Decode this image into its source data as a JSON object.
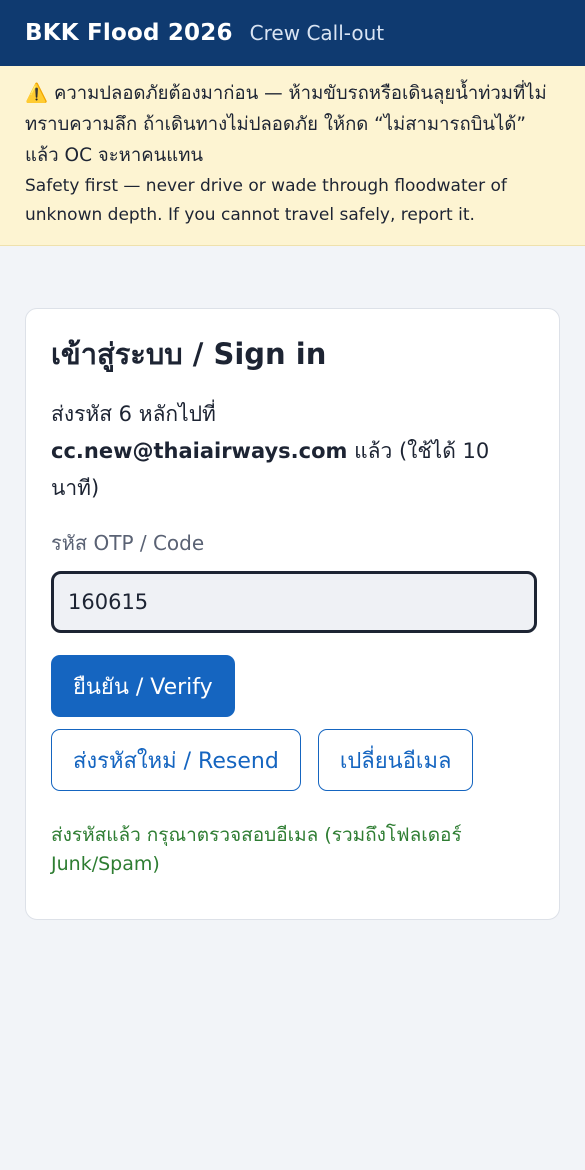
{
  "header": {
    "title": "BKK Flood 2026",
    "subtitle": "Crew Call-out"
  },
  "banner": {
    "icon": "warning-icon",
    "icon_glyph": "⚠️",
    "text_th": "ความปลอดภัยต้องมาก่อน — ห้ามขับรถหรือเดินลุยน้ำท่วมที่ไม่ทราบความลึก ถ้าเดินทางไม่ปลอดภัย ให้กด “ไม่สามารถบินได้” แล้ว OC จะหาคนแทน",
    "text_en": "Safety first — never drive or wade through floodwater of unknown depth. If you cannot travel safely, report it."
  },
  "signin": {
    "title": "เข้าสู่ระบบ / Sign in",
    "instruction_prefix": "ส่งรหัส 6 หลักไปที่",
    "email": "cc.new@thaiairways.com",
    "instruction_suffix": "แล้ว (ใช้ได้ 10 นาที)",
    "otp_label": "รหัส OTP / Code",
    "otp_value": "160615",
    "verify_label": "ยืนยัน / Verify",
    "resend_label": "ส่งรหัสใหม่ / Resend",
    "change_email_label": "เปลี่ยนอีเมล",
    "status_message": "ส่งรหัสแล้ว กรุณาตรวจสอบอีเมล (รวมถึงโฟลเดอร์ Junk/Spam)"
  },
  "colors": {
    "header_bg": "#0f3a70",
    "banner_bg": "#fdf4d2",
    "primary": "#1565c0",
    "success_text": "#2e7d32",
    "page_bg": "#f2f4f8"
  }
}
